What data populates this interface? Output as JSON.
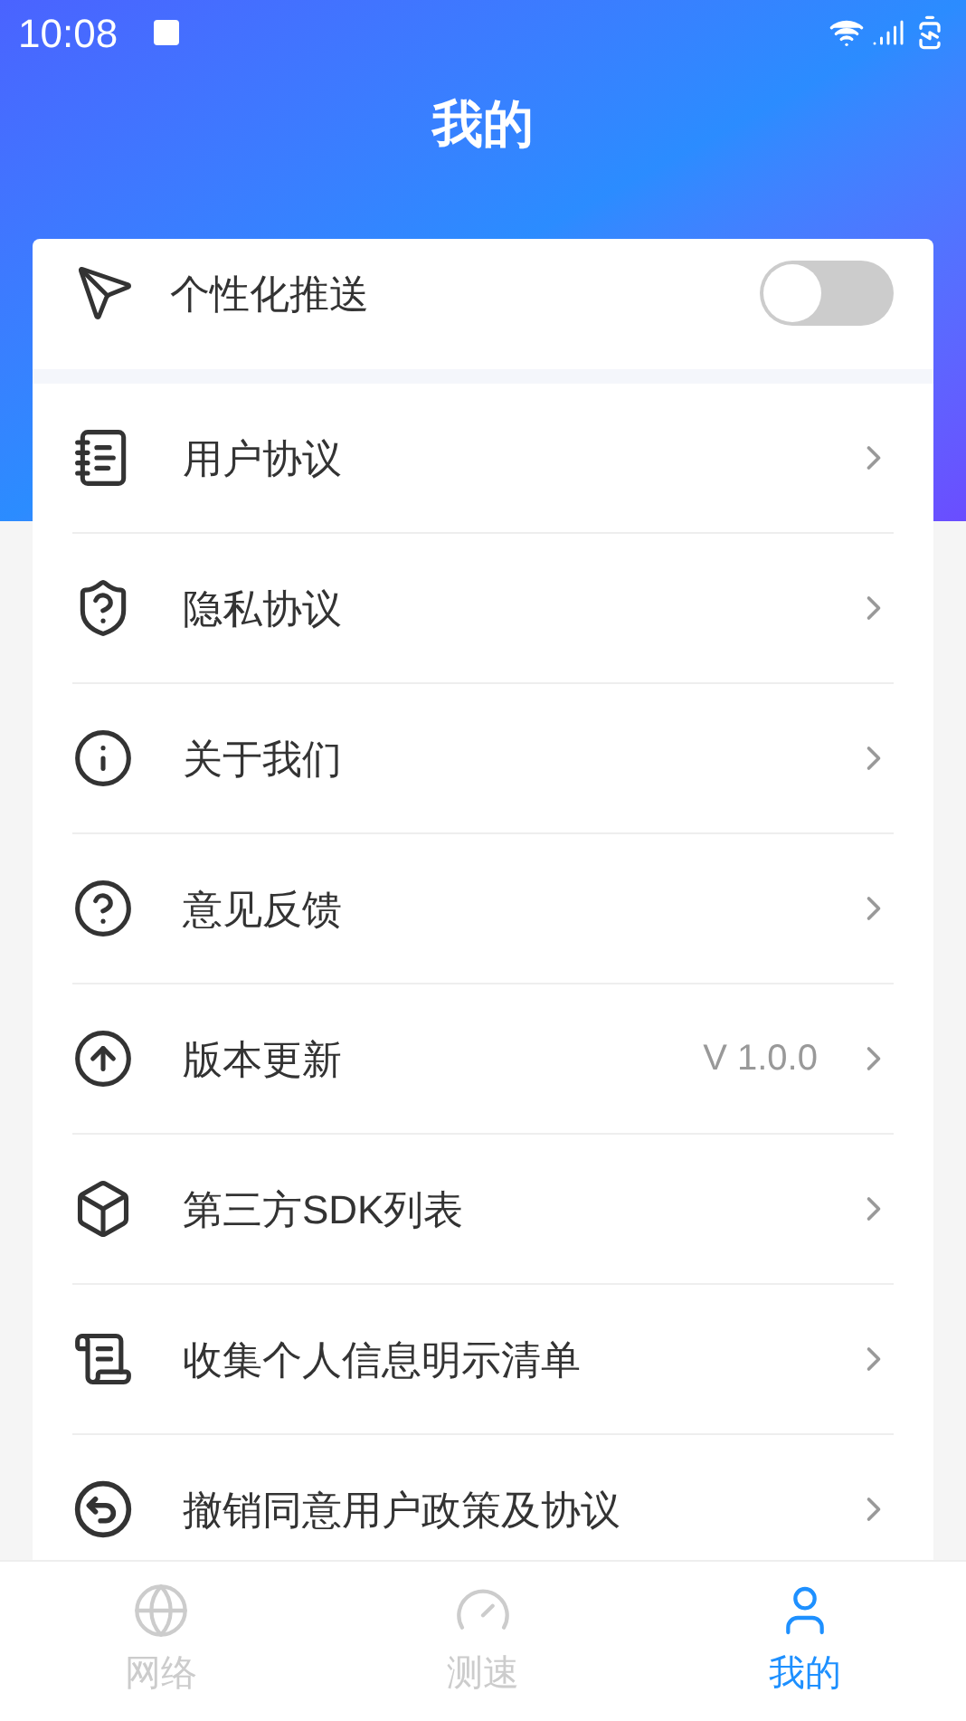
{
  "status_bar": {
    "time": "10:08"
  },
  "header": {
    "title": "我的"
  },
  "push_setting": {
    "label": "个性化推送",
    "on": false
  },
  "menu": [
    {
      "label": "用户协议"
    },
    {
      "label": "隐私协议"
    },
    {
      "label": "关于我们"
    },
    {
      "label": "意见反馈"
    },
    {
      "label": "版本更新",
      "value": "V 1.0.0"
    },
    {
      "label": "第三方SDK列表"
    },
    {
      "label": "收集个人信息明示清单"
    },
    {
      "label": "撤销同意用户政策及协议"
    }
  ],
  "tabs": [
    {
      "label": "网络",
      "selected": false
    },
    {
      "label": "测速",
      "selected": false
    },
    {
      "label": "我的",
      "selected": true
    }
  ]
}
